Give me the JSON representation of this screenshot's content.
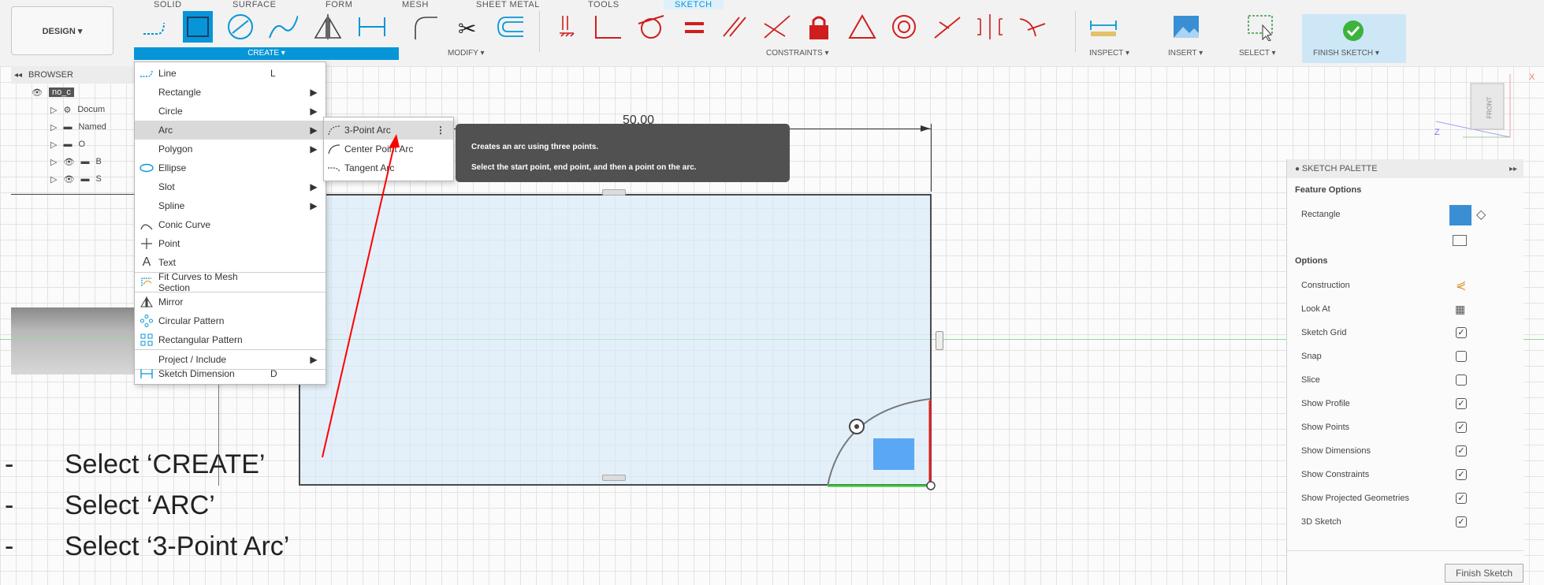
{
  "tabs": [
    "SOLID",
    "SURFACE",
    "FORM",
    "MESH",
    "SHEET METAL",
    "TOOLS",
    "SKETCH"
  ],
  "design_label": "DESIGN ▾",
  "groups": {
    "create": "CREATE ▾",
    "modify": "MODIFY ▾",
    "constraints": "CONSTRAINTS ▾",
    "inspect": "INSPECT ▾",
    "insert": "INSERT ▾",
    "select": "SELECT ▾",
    "finish": "FINISH SKETCH ▾"
  },
  "browser": {
    "title": "BROWSER",
    "items": [
      "no_c",
      "Docum",
      "Named",
      "O",
      "B",
      "S"
    ]
  },
  "create_menu": [
    {
      "label": "Line",
      "shortcut": "L",
      "submenu": false,
      "icon": "line-icon"
    },
    {
      "label": "Rectangle",
      "shortcut": "",
      "submenu": true,
      "icon": ""
    },
    {
      "label": "Circle",
      "shortcut": "",
      "submenu": true,
      "icon": ""
    },
    {
      "label": "Arc",
      "shortcut": "",
      "submenu": true,
      "icon": ""
    },
    {
      "label": "Polygon",
      "shortcut": "",
      "submenu": true,
      "icon": ""
    },
    {
      "label": "Ellipse",
      "shortcut": "",
      "submenu": false,
      "icon": "ellipse-icon"
    },
    {
      "label": "Slot",
      "shortcut": "",
      "submenu": true,
      "icon": ""
    },
    {
      "label": "Spline",
      "shortcut": "",
      "submenu": true,
      "icon": ""
    },
    {
      "label": "Conic Curve",
      "shortcut": "",
      "submenu": false,
      "icon": "conic-curve-icon"
    },
    {
      "label": "Point",
      "shortcut": "",
      "submenu": false,
      "icon": "point-icon"
    },
    {
      "label": "Text",
      "shortcut": "",
      "submenu": false,
      "icon": "text-icon"
    },
    {
      "label": "Fit Curves to Mesh Section",
      "shortcut": "",
      "submenu": false,
      "icon": "fit-curves-icon"
    },
    {
      "label": "Mirror",
      "shortcut": "",
      "submenu": false,
      "icon": "mirror-icon"
    },
    {
      "label": "Circular Pattern",
      "shortcut": "",
      "submenu": false,
      "icon": "circular-pattern-icon"
    },
    {
      "label": "Rectangular Pattern",
      "shortcut": "",
      "submenu": false,
      "icon": "rectangular-pattern-icon"
    },
    {
      "label": "Project / Include",
      "shortcut": "",
      "submenu": true,
      "icon": ""
    },
    {
      "label": "Sketch Dimension",
      "shortcut": "D",
      "submenu": false,
      "icon": "sketch-dimension-icon"
    }
  ],
  "arc_submenu": [
    "3-Point Arc",
    "Center Point Arc",
    "Tangent Arc"
  ],
  "tooltip": {
    "line1": "Creates an arc using three points.",
    "line2": "Select the start point, end point, and then a point on the arc."
  },
  "dimension": "50.00",
  "viewcube": {
    "face": "FRONT",
    "axis_z": "Z",
    "axis_x": "X"
  },
  "palette": {
    "title": "SKETCH PALETTE",
    "feature_options": "Feature Options",
    "rectangle": "Rectangle",
    "options": "Options",
    "rows": [
      {
        "label": "Construction",
        "state": "icon"
      },
      {
        "label": "Look At",
        "state": "icon"
      },
      {
        "label": "Sketch Grid",
        "state": "checked"
      },
      {
        "label": "Snap",
        "state": "unchecked"
      },
      {
        "label": "Slice",
        "state": "unchecked"
      },
      {
        "label": "Show Profile",
        "state": "checked"
      },
      {
        "label": "Show Points",
        "state": "checked"
      },
      {
        "label": "Show Dimensions",
        "state": "checked"
      },
      {
        "label": "Show Constraints",
        "state": "checked"
      },
      {
        "label": "Show Projected Geometries",
        "state": "checked"
      },
      {
        "label": "3D Sketch",
        "state": "checked"
      }
    ],
    "finish_button": "Finish Sketch"
  },
  "instructions": [
    "-",
    "Select ‘CREATE’",
    "-",
    "Select ‘ARC’",
    "-",
    "Select ‘3-Point Arc’"
  ],
  "colors": {
    "accent": "#0696d7",
    "arrow": "#ff0000",
    "tooltip_bg": "#515151",
    "sketch_fill": "#d6eaf8"
  }
}
